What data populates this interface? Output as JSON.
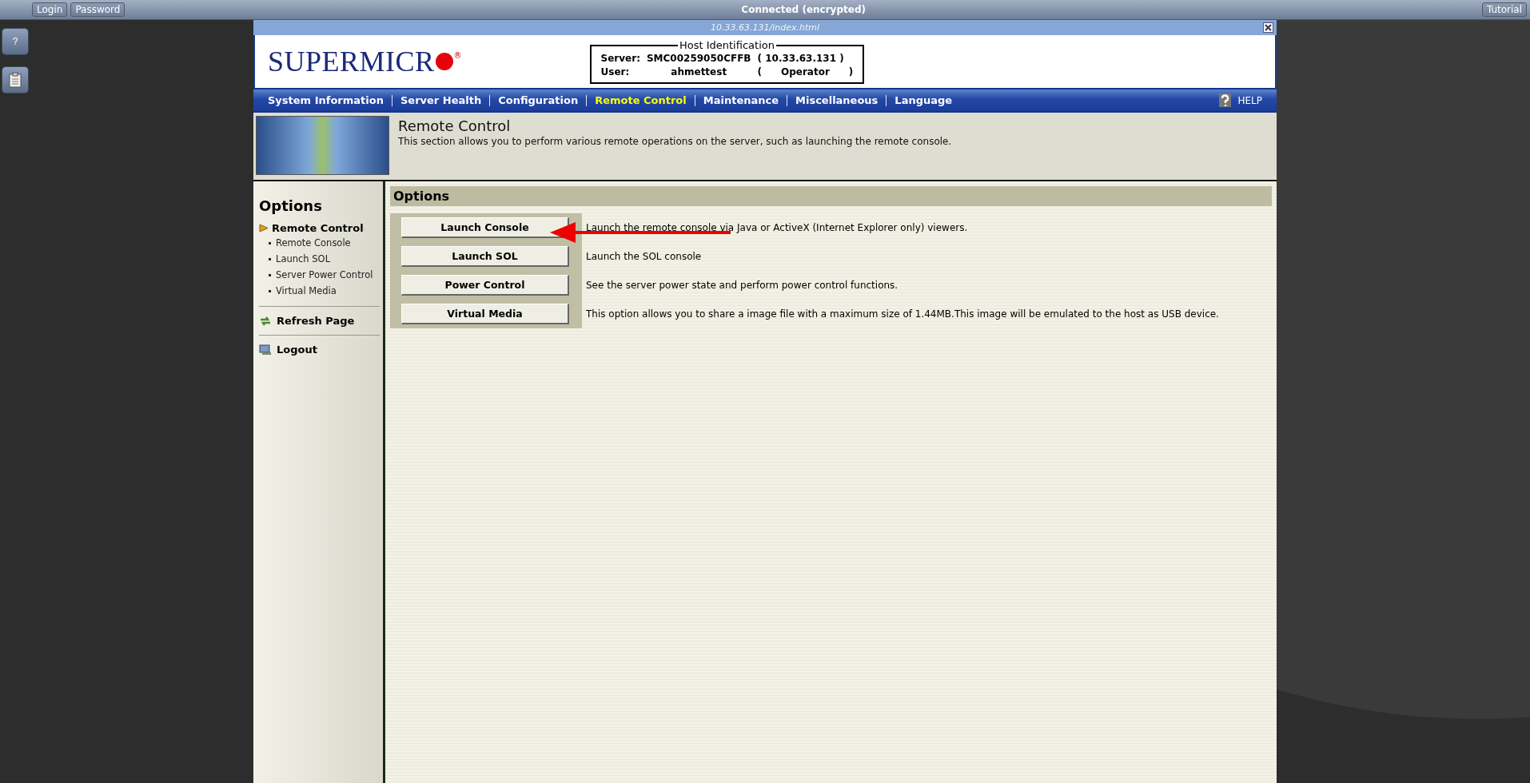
{
  "top_bar": {
    "buttons": [
      "Login",
      "Password"
    ],
    "status": "Connected (encrypted)",
    "tutorial": "Tutorial"
  },
  "side_tools": [
    {
      "kind": "help",
      "label": "?"
    },
    {
      "kind": "clipboard"
    }
  ],
  "window": {
    "title": "10.33.63.131/index.html"
  },
  "header": {
    "logo": "SUPERMICR",
    "registered": "®",
    "host": {
      "legend": "Host Identification",
      "server_label": "Server:",
      "server_name": "SMC00259050CFFB",
      "server_ip": "( 10.33.63.131 )",
      "user_label": "User:",
      "user_name": "ahmettest",
      "role_open": "(",
      "role": "Operator",
      "role_close": ")"
    }
  },
  "nav": {
    "items": [
      {
        "label": "System Information",
        "selected": false
      },
      {
        "label": "Server Health",
        "selected": false
      },
      {
        "label": "Configuration",
        "selected": false
      },
      {
        "label": "Remote Control",
        "selected": true
      },
      {
        "label": "Maintenance",
        "selected": false
      },
      {
        "label": "Miscellaneous",
        "selected": false
      },
      {
        "label": "Language",
        "selected": false
      }
    ],
    "help": "HELP"
  },
  "section": {
    "title": "Remote Control",
    "description": "This section allows you to perform various remote operations on the server, such as launching the remote console."
  },
  "sidebar": {
    "title": "Options",
    "groups": [
      {
        "label": "Remote Control",
        "expanded": true,
        "children": [
          {
            "label": "Remote Console"
          },
          {
            "label": "Launch SOL"
          },
          {
            "label": "Server Power Control"
          },
          {
            "label": "Virtual Media"
          }
        ]
      }
    ],
    "actions": [
      {
        "kind": "refresh",
        "label": "Refresh Page"
      },
      {
        "kind": "logout",
        "label": "Logout"
      }
    ]
  },
  "options": {
    "title": "Options",
    "rows": [
      {
        "button": "Launch Console",
        "description": "Launch the remote console via Java or ActiveX (Internet Explorer only) viewers."
      },
      {
        "button": "Launch SOL",
        "description": "Launch the SOL console"
      },
      {
        "button": "Power Control",
        "description": "See the server power state and perform power control functions."
      },
      {
        "button": "Virtual Media",
        "description": "This option allows you to share a image file with a maximum size of 1.44MB.This image will be emulated to the host as USB device."
      }
    ]
  }
}
